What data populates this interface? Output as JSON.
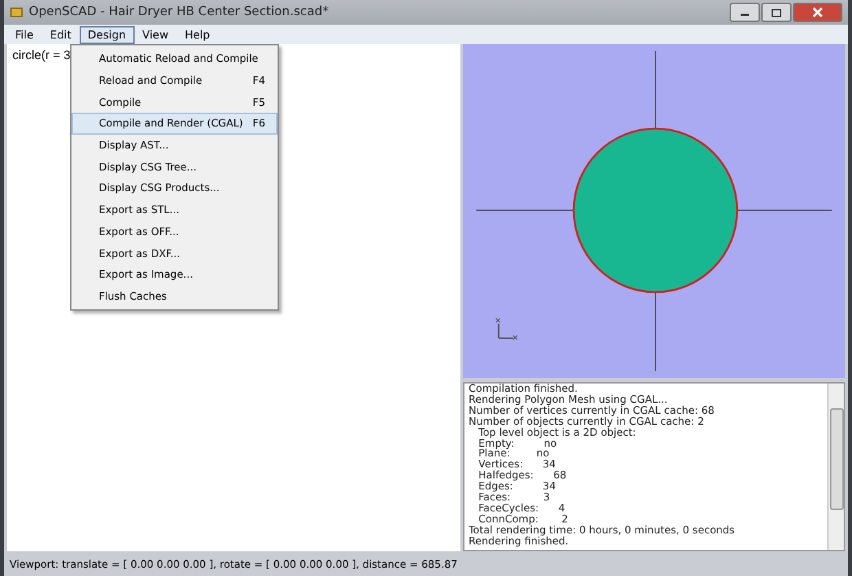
{
  "window": {
    "title": "OpenSCAD - Hair Dryer HB Center Section.scad*"
  },
  "menubar": [
    {
      "label": "File",
      "selected": false
    },
    {
      "label": "Edit",
      "selected": false
    },
    {
      "label": "Design",
      "selected": true
    },
    {
      "label": "View",
      "selected": false
    },
    {
      "label": "Help",
      "selected": false
    }
  ],
  "editor": {
    "text": "circle(r = 3"
  },
  "menu": [
    {
      "label": "Automatic Reload and Compile",
      "selected": false
    },
    {
      "label": "Reload and Compile",
      "shortcut": "F4",
      "selected": false
    },
    {
      "label": "Compile",
      "shortcut": "F5",
      "selected": false
    },
    {
      "label": "Compile and Render (CGAL)",
      "shortcut": "F6",
      "selected": true
    },
    {
      "label": "Display AST...",
      "selected": false
    },
    {
      "label": "Display CSG Tree...",
      "selected": false
    },
    {
      "label": "Display CSG Products...",
      "selected": false
    },
    {
      "label": "Export as STL...",
      "selected": false
    },
    {
      "label": "Export as OFF...",
      "selected": false
    },
    {
      "label": "Export as DXF...",
      "selected": false
    },
    {
      "label": "Export as Image...",
      "selected": false
    },
    {
      "label": "Flush Caches",
      "selected": false
    }
  ],
  "console": [
    "Compilation finished.",
    "Rendering Polygon Mesh using CGAL...",
    "Number of vertices currently in CGAL cache: 68",
    "Number of objects currently in CGAL cache: 2",
    "   Top level object is a 2D object:",
    "   Empty:         no",
    "   Plane:        no",
    "   Vertices:      34",
    "   Halfedges:      68",
    "   Edges:         34",
    "   Faces:          3",
    "   FaceCycles:      4",
    "   ConnComp:       2",
    "Total rendering time: 0 hours, 0 minutes, 0 seconds",
    "Rendering finished."
  ],
  "status_bar": "Viewport: translate = [ 0.00 0.00 0.00 ], rotate = [ 0.00 0.00 0.00 ], distance = 685.87"
}
